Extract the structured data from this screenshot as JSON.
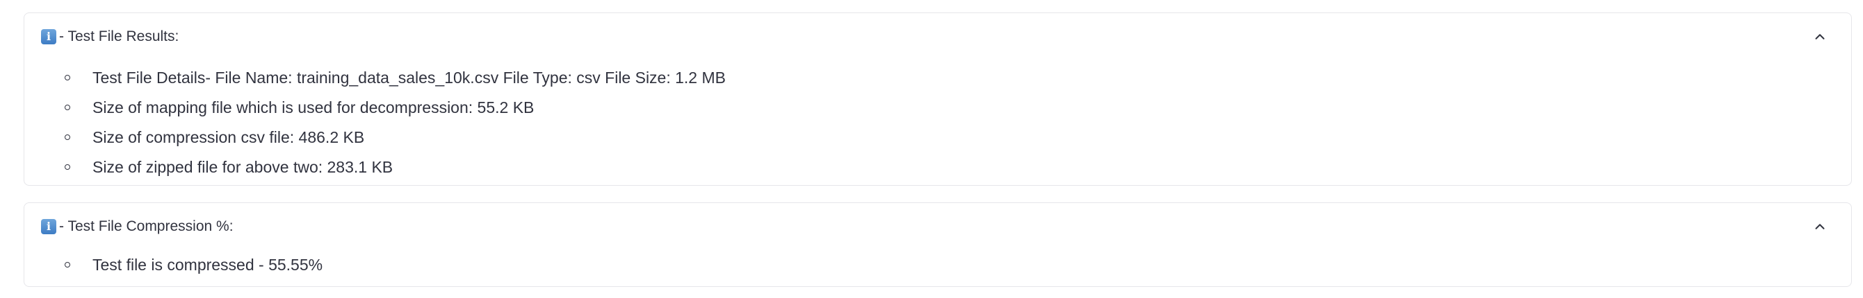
{
  "expanders": [
    {
      "icon": "info-icon",
      "icon_glyph": "i",
      "title": "- Test File Results:",
      "expanded": true,
      "items": [
        "Test File Details- File Name: training_data_sales_10k.csv File Type: csv File Size: 1.2 MB",
        "Size of mapping file which is used for decompression: 55.2 KB",
        "Size of compression csv file: 486.2 KB",
        "Size of zipped file for above two: 283.1 KB"
      ]
    },
    {
      "icon": "info-icon",
      "icon_glyph": "i",
      "title": "- Test File Compression %:",
      "expanded": true,
      "items": [
        "Test file is compressed - 55.55%"
      ]
    }
  ],
  "colors": {
    "text": "#31333f",
    "border": "#e6e6ea",
    "icon_bg": "#3d7cc4"
  }
}
